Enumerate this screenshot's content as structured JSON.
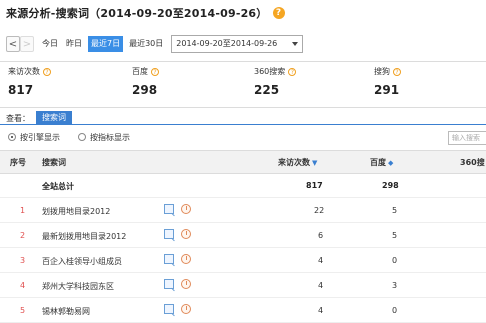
{
  "header": {
    "title": "来源分析-搜索词（2014-09-20至2014-09-26）",
    "help": "?"
  },
  "toolbar": {
    "prev": "<",
    "next": ">",
    "ranges": [
      "今日",
      "昨日",
      "最近7日",
      "最近30日"
    ],
    "active_range": "最近7日",
    "date_value": "2014-09-20至2014-09-26"
  },
  "metrics": [
    {
      "label": "来访次数",
      "value": "817"
    },
    {
      "label": "百度",
      "value": "298"
    },
    {
      "label": "360搜索",
      "value": "225"
    },
    {
      "label": "搜狗",
      "value": "291"
    }
  ],
  "view": {
    "label": "查看：",
    "tab": "搜索词"
  },
  "radios": [
    {
      "label": "按引擎显示",
      "checked": true
    },
    {
      "label": "按指标显示",
      "checked": false
    }
  ],
  "search": {
    "placeholder": "输入搜索"
  },
  "table": {
    "headers": {
      "idx": "序号",
      "keyword": "搜索词",
      "visits": "来访次数",
      "baidu": "百度",
      "s360": "360搜"
    },
    "total": {
      "label": "全站总计",
      "visits": "817",
      "baidu": "298"
    },
    "rows": [
      {
        "idx": "1",
        "keyword": "划拨用地目录2012",
        "visits": "22",
        "baidu": "5"
      },
      {
        "idx": "2",
        "keyword": "最新划拨用地目录2012",
        "visits": "6",
        "baidu": "5"
      },
      {
        "idx": "3",
        "keyword": "百企入桂领导小组成员",
        "visits": "4",
        "baidu": "0"
      },
      {
        "idx": "4",
        "keyword": "郑州大学科技园东区",
        "visits": "4",
        "baidu": "3"
      },
      {
        "idx": "5",
        "keyword": "锡林郭勒易网",
        "visits": "4",
        "baidu": "0"
      }
    ]
  }
}
